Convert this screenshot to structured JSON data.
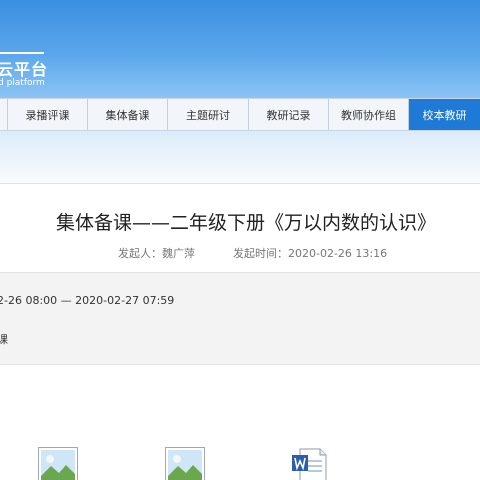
{
  "header": {
    "logo_text": "云平台",
    "logo_subtext": "d platform"
  },
  "nav": {
    "items": [
      {
        "label": "录播评课"
      },
      {
        "label": "集体备课"
      },
      {
        "label": "主题研讨"
      },
      {
        "label": "教研记录"
      },
      {
        "label": "教师协作组"
      },
      {
        "label": "校本教研"
      }
    ],
    "active_index": 5,
    "active_color": "#1f79d6"
  },
  "article": {
    "title": "集体备课——二年级下册《万以内数的认识》",
    "sponsor": "发起人：魏广萍",
    "start_time": "发起时间：2020-02-26 13:16",
    "period": "2-26 08:00 — 2020-02-27 07:59",
    "type": "课"
  },
  "attachments": [
    {
      "icon": "image-file-icon"
    },
    {
      "icon": "image-file-icon"
    },
    {
      "icon": "word-document-icon"
    }
  ]
}
